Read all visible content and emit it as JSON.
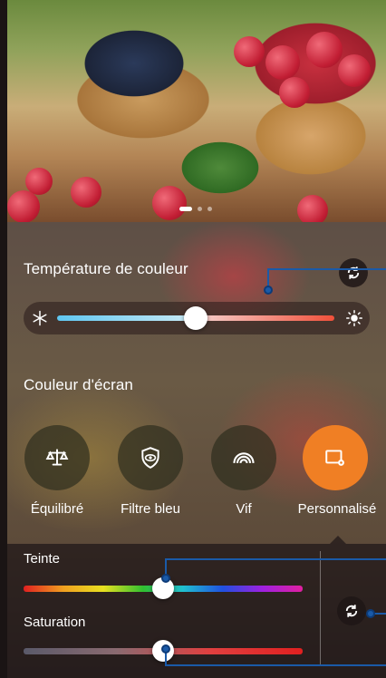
{
  "temperature": {
    "title": "Température de couleur",
    "value": 0.5,
    "cold_icon": "snowflake-icon",
    "warm_icon": "sun-icon",
    "reset_icon": "refresh-icon"
  },
  "screen_color": {
    "title": "Couleur d'écran",
    "modes": [
      {
        "label": "Équilibré",
        "icon": "balance-scale-icon",
        "active": false
      },
      {
        "label": "Filtre bleu",
        "icon": "eye-shield-icon",
        "active": false
      },
      {
        "label": "Vif",
        "icon": "rainbow-icon",
        "active": false
      },
      {
        "label": "Personnalisé",
        "icon": "custom-screen-icon",
        "active": true
      }
    ]
  },
  "custom": {
    "hue_label": "Teinte",
    "hue_value": 0.5,
    "saturation_label": "Saturation",
    "saturation_value": 0.5,
    "reset_icon": "refresh-icon"
  },
  "colors": {
    "accent_active": "#f07f24",
    "callout": "#1a5aa8"
  }
}
